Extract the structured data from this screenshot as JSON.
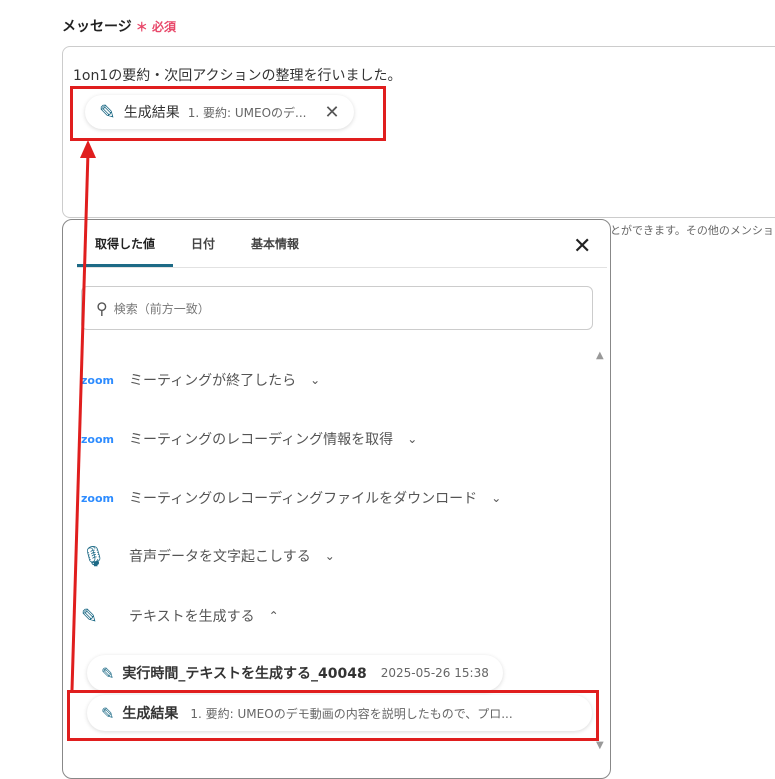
{
  "field": {
    "label": "メッセージ",
    "required_mark": "＊",
    "required_text": "必須",
    "text": "1on1の要約・次回アクションの整理を行いました。",
    "chip": {
      "title": "生成結果",
      "value": "1. 要約: UMEOのデ..."
    }
  },
  "hint": "とができます。その他のメンショ",
  "panel": {
    "tabs": [
      {
        "label": "取得した値"
      },
      {
        "label": "日付"
      },
      {
        "label": "基本情報"
      }
    ],
    "search_placeholder": "検索（前方一致）",
    "sections": [
      {
        "icon": "zoom-logo",
        "logo_text": "zoom",
        "label": "ミーティングが終了したら",
        "state": "collapsed"
      },
      {
        "icon": "zoom-logo",
        "logo_text": "zoom",
        "label": "ミーティングのレコーディング情報を取得",
        "state": "collapsed"
      },
      {
        "icon": "zoom-logo",
        "logo_text": "zoom",
        "label": "ミーティングのレコーディングファイルをダウンロード",
        "state": "collapsed"
      },
      {
        "icon": "mic-pen-icon",
        "label": "音声データを文字起こしする",
        "state": "collapsed"
      },
      {
        "icon": "pen-icon",
        "label": "テキストを生成する",
        "state": "expanded"
      }
    ],
    "values": [
      {
        "title": "実行時間_テキストを生成する_40048",
        "value": "2025-05-26 15:38"
      },
      {
        "title": "生成結果",
        "value": "1. 要約: UMEOのデモ動画の内容を説明したもので、プロ..."
      }
    ]
  },
  "colors": {
    "accent": "#1d6a86",
    "highlight": "#e01e1e",
    "required": "#e8486a",
    "zoom": "#2d8cff"
  }
}
